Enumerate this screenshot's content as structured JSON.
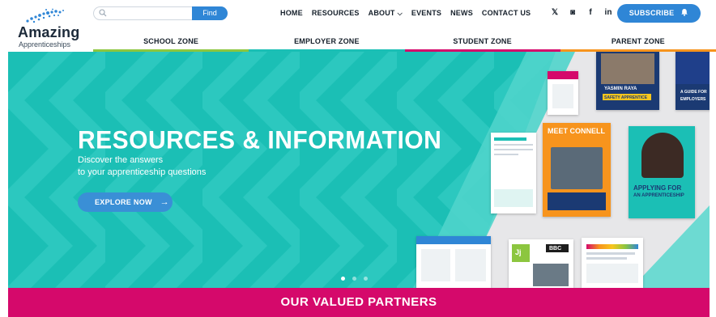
{
  "brand": {
    "name": "Amazing",
    "subtitle": "Apprenticeships"
  },
  "search": {
    "placeholder": "",
    "button_label": "Find"
  },
  "nav": {
    "items": [
      "HOME",
      "RESOURCES",
      "ABOUT",
      "EVENTS",
      "NEWS",
      "CONTACT US"
    ]
  },
  "social": {
    "x": "𝕏",
    "instagram": "◙",
    "facebook": "f",
    "linkedin": "in"
  },
  "subscribe": {
    "label": "SUBSCRIBE"
  },
  "zones": [
    {
      "label": "SCHOOL ZONE",
      "color": "#8cc63f"
    },
    {
      "label": "EMPLOYER ZONE",
      "color": "#1bbfb5"
    },
    {
      "label": "STUDENT ZONE",
      "color": "#d5096b"
    },
    {
      "label": "PARENT ZONE",
      "color": "#f7941d"
    }
  ],
  "hero": {
    "title": "RESOURCES & INFORMATION",
    "line1": "Discover the answers",
    "line2": "to your apprenticeship questions",
    "cta": "EXPLORE NOW",
    "slides_total": 3,
    "slide_active": 1
  },
  "cards": {
    "yasmin": "YASMIN RAYA",
    "safety": "SAFETY APPRENTICE",
    "connell_1": "MEET CONNELL",
    "applying_1": "APPLYING FOR",
    "applying_2": "AN APPRENTICESHIP",
    "guide": "A GUIDE FOR EMPLOYERS",
    "bbc": "BBC",
    "jj": "Jj"
  },
  "partners": {
    "title": "OUR VALUED PARTNERS"
  },
  "colors": {
    "teal": "#1bbfb5",
    "blue": "#2f86d6",
    "magenta": "#d5096b",
    "orange": "#f7941d",
    "green": "#8cc63f"
  }
}
